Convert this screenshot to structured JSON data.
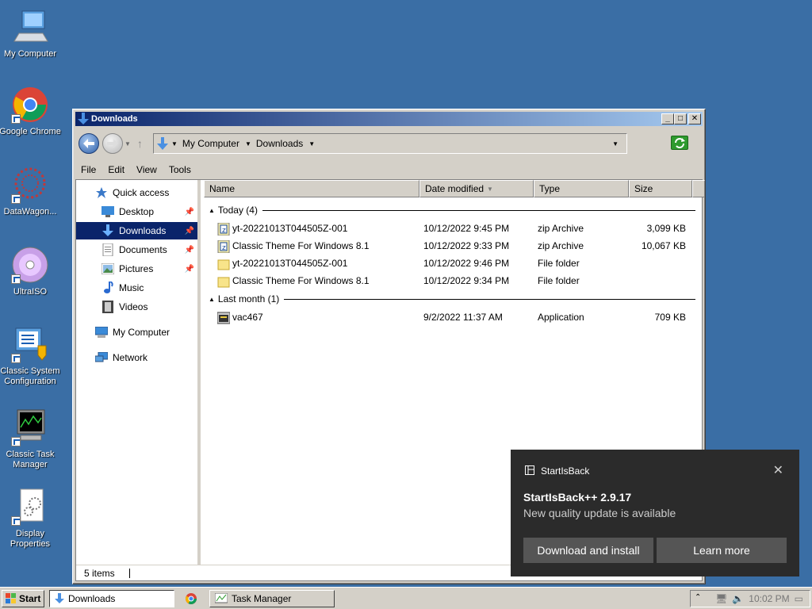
{
  "desktop": {
    "icons": [
      {
        "label": "My Computer",
        "icon": "computer-icon"
      },
      {
        "label": "Google Chrome",
        "icon": "chrome-icon"
      },
      {
        "label": "DataWagon...",
        "icon": "datawagon-icon"
      },
      {
        "label": "UltraISO",
        "icon": "disc-icon"
      },
      {
        "label": "Classic System Configuration",
        "icon": "system-config-icon"
      },
      {
        "label": "Classic Task Manager",
        "icon": "task-manager-icon"
      },
      {
        "label": "Display Properties",
        "icon": "display-properties-icon"
      }
    ]
  },
  "window": {
    "title": "Downloads",
    "breadcrumb": [
      "My Computer",
      "Downloads"
    ],
    "menu": [
      "File",
      "Edit",
      "View",
      "Tools"
    ]
  },
  "nav_pane": {
    "items": [
      {
        "label": "Quick access",
        "icon": "star-icon",
        "pinned": false
      },
      {
        "label": "Desktop",
        "icon": "desktop-icon",
        "pinned": true
      },
      {
        "label": "Downloads",
        "icon": "download-arrow-icon",
        "pinned": true,
        "selected": true
      },
      {
        "label": "Documents",
        "icon": "documents-icon",
        "pinned": true
      },
      {
        "label": "Pictures",
        "icon": "pictures-icon",
        "pinned": true
      },
      {
        "label": "Music",
        "icon": "music-icon",
        "pinned": false
      },
      {
        "label": "Videos",
        "icon": "videos-icon",
        "pinned": false
      },
      {
        "label": "My Computer",
        "icon": "computer-icon",
        "pinned": false
      },
      {
        "label": "Network",
        "icon": "network-icon",
        "pinned": false
      }
    ]
  },
  "file_list": {
    "columns": [
      "Name",
      "Date modified",
      "Type",
      "Size"
    ],
    "groups": [
      {
        "label": "Today (4)",
        "files": [
          {
            "name": "yt-20221013T044505Z-001",
            "date": "10/12/2022 9:45 PM",
            "type": "zip Archive",
            "size": "3,099 KB",
            "icon": "zip-icon"
          },
          {
            "name": "Classic Theme For Windows 8.1",
            "date": "10/12/2022 9:33 PM",
            "type": "zip Archive",
            "size": "10,067 KB",
            "icon": "zip-icon"
          },
          {
            "name": "yt-20221013T044505Z-001",
            "date": "10/12/2022 9:46 PM",
            "type": "File folder",
            "size": "",
            "icon": "folder-icon"
          },
          {
            "name": "Classic Theme For Windows 8.1",
            "date": "10/12/2022 9:34 PM",
            "type": "File folder",
            "size": "",
            "icon": "folder-icon"
          }
        ]
      },
      {
        "label": "Last month (1)",
        "files": [
          {
            "name": "vac467",
            "date": "9/2/2022 11:37 AM",
            "type": "Application",
            "size": "709 KB",
            "icon": "application-icon"
          }
        ]
      }
    ]
  },
  "status": {
    "items_count": "5 items"
  },
  "notification": {
    "app": "StartIsBack",
    "title": "StartIsBack++ 2.9.17",
    "message": "New quality update is available",
    "primary_button": "Download and install",
    "secondary_button": "Learn more"
  },
  "taskbar": {
    "start": "Start",
    "tasks": [
      {
        "label": "Downloads",
        "active": true
      },
      {
        "label": "Task Manager",
        "active": false
      }
    ],
    "clock": "10:02 PM"
  }
}
